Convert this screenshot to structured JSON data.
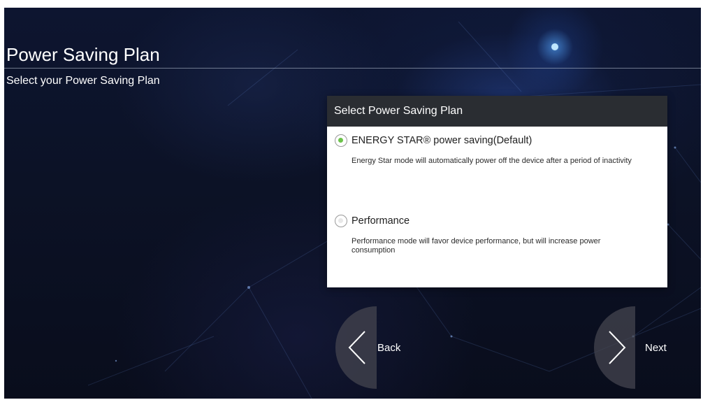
{
  "page": {
    "title": "Power Saving Plan",
    "subtitle": "Select your Power Saving Plan"
  },
  "dialog": {
    "title": "Select Power Saving Plan",
    "options": [
      {
        "label": "ENERGY STAR® power saving(Default)",
        "description": "Energy Star mode will automatically power off the device after a period of inactivity",
        "selected": true
      },
      {
        "label": "Performance",
        "description": "Performance mode will favor device performance, but will increase power consumption",
        "selected": false
      }
    ]
  },
  "navigation": {
    "back_label": "Back",
    "next_label": "Next",
    "back_icon": "chevron-left-icon",
    "next_icon": "chevron-right-icon"
  },
  "colors": {
    "selected_radio": "#6cc24a",
    "unselected_radio": "#e8e8e8",
    "dialog_header": "#2a2d32"
  }
}
